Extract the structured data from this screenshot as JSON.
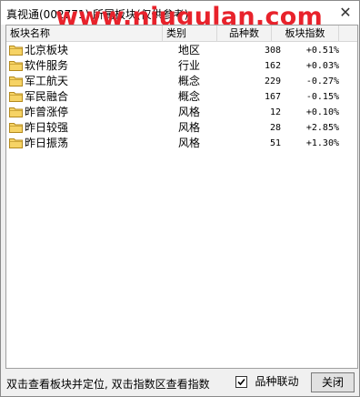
{
  "window": {
    "title": "真视通(002771)  所属板块(仅供参考)",
    "watermark": "www.niugulan.com"
  },
  "table": {
    "headers": [
      "板块名称",
      "类别",
      "品种数",
      "板块指数"
    ],
    "rows": [
      {
        "name": "北京板块",
        "type": "地区",
        "count": "308",
        "index": "+0.51%"
      },
      {
        "name": "软件服务",
        "type": "行业",
        "count": "162",
        "index": "+0.03%"
      },
      {
        "name": "军工航天",
        "type": "概念",
        "count": "229",
        "index": "-0.27%"
      },
      {
        "name": "军民融合",
        "type": "概念",
        "count": "167",
        "index": "-0.15%"
      },
      {
        "name": "昨曾涨停",
        "type": "风格",
        "count": "12",
        "index": "+0.10%"
      },
      {
        "name": "昨日较强",
        "type": "风格",
        "count": "28",
        "index": "+2.85%"
      },
      {
        "name": "昨日振荡",
        "type": "风格",
        "count": "51",
        "index": "+1.30%"
      }
    ]
  },
  "footer": {
    "hint": "双击查看板块并定位, 双击指数区查看指数",
    "checkbox_label": "品种联动",
    "checkbox_checked": true,
    "close_label": "关闭"
  },
  "colors": {
    "folder_fill": "#f6d365",
    "folder_stroke": "#b48a1e",
    "watermark": "#e8222b"
  }
}
